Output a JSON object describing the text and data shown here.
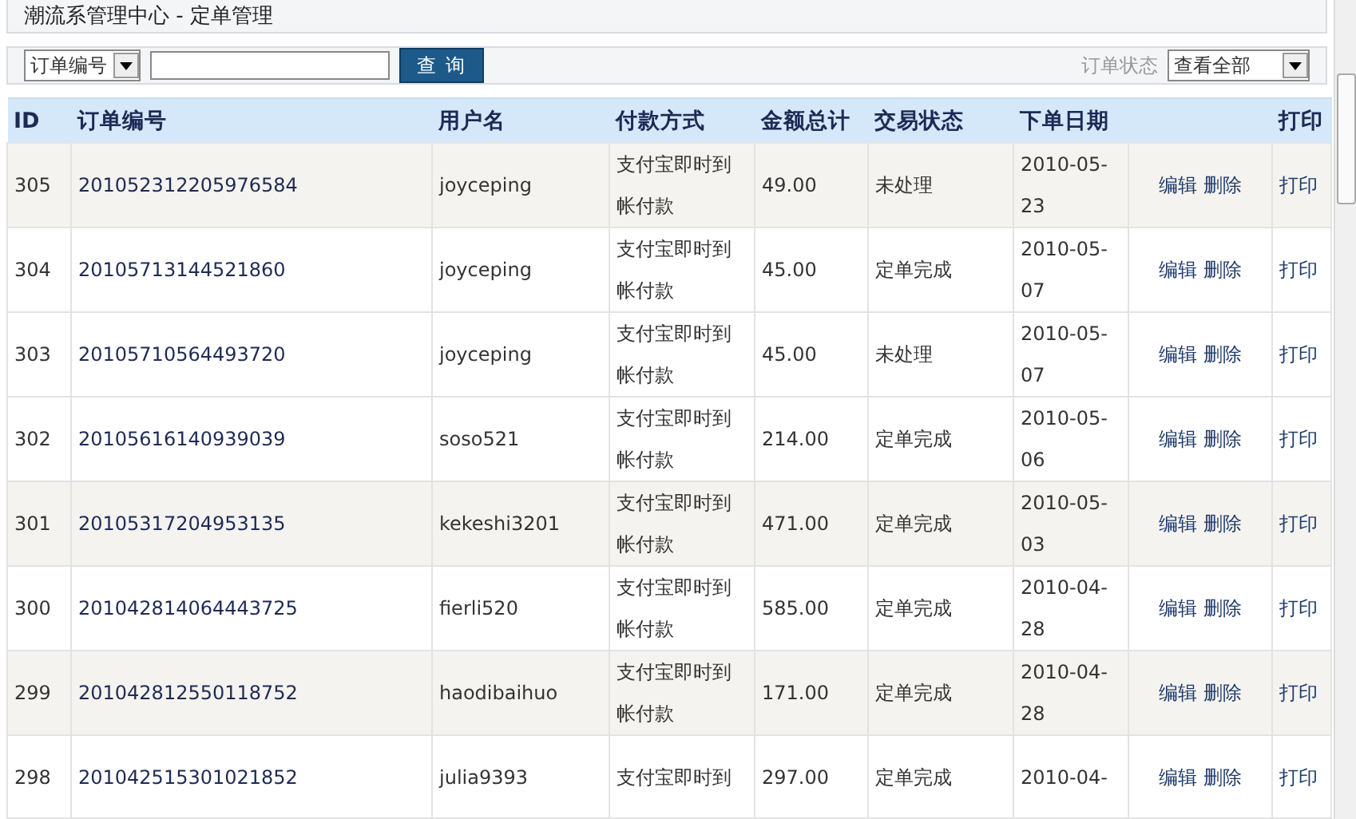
{
  "window": {
    "title": "潮流系管理中心 - 定单管理"
  },
  "search": {
    "field_select": "订单编号",
    "button": "查 询",
    "status_label": "订单状态",
    "status_select": "查看全部"
  },
  "table": {
    "columns": [
      "ID",
      "订单编号",
      "用户名",
      "付款方式",
      "金额总计",
      "交易状态",
      "下单日期",
      "打印"
    ],
    "rows": [
      {
        "id": "305",
        "order_no": "201052312205976584",
        "user": "joyceping",
        "payment": "支付宝即时到帐付款",
        "total": "49.00",
        "status": "未处理",
        "date": "2010-05-23",
        "edit": "编辑",
        "delete": "删除",
        "print": "打印",
        "shaded": true
      },
      {
        "id": "304",
        "order_no": "20105713144521860",
        "user": "joyceping",
        "payment": "支付宝即时到帐付款",
        "total": "45.00",
        "status": "定单完成",
        "date": "2010-05-07",
        "edit": "编辑",
        "delete": "删除",
        "print": "打印",
        "shaded": false
      },
      {
        "id": "303",
        "order_no": "20105710564493720",
        "user": "joyceping",
        "payment": "支付宝即时到帐付款",
        "total": "45.00",
        "status": "未处理",
        "date": "2010-05-07",
        "edit": "编辑",
        "delete": "删除",
        "print": "打印",
        "shaded": false
      },
      {
        "id": "302",
        "order_no": "20105616140939039",
        "user": "soso521",
        "payment": "支付宝即时到帐付款",
        "total": "214.00",
        "status": "定单完成",
        "date": "2010-05-06",
        "edit": "编辑",
        "delete": "删除",
        "print": "打印",
        "shaded": false
      },
      {
        "id": "301",
        "order_no": "20105317204953135",
        "user": "kekeshi3201",
        "payment": "支付宝即时到帐付款",
        "total": "471.00",
        "status": "定单完成",
        "date": "2010-05-03",
        "edit": "编辑",
        "delete": "删除",
        "print": "打印",
        "shaded": true
      },
      {
        "id": "300",
        "order_no": "201042814064443725",
        "user": "fierli520",
        "payment": "支付宝即时到帐付款",
        "total": "585.00",
        "status": "定单完成",
        "date": "2010-04-28",
        "edit": "编辑",
        "delete": "删除",
        "print": "打印",
        "shaded": false
      },
      {
        "id": "299",
        "order_no": "201042812550118752",
        "user": "haodibaihuo",
        "payment": "支付宝即时到帐付款",
        "total": "171.00",
        "status": "定单完成",
        "date": "2010-04-28",
        "edit": "编辑",
        "delete": "删除",
        "print": "打印",
        "shaded": true
      },
      {
        "id": "298",
        "order_no": "201042515301021852",
        "user": "julia9393",
        "payment": "支付宝即时到",
        "total": "297.00",
        "status": "定单完成",
        "date": "2010-04-",
        "edit": "编辑",
        "delete": "删除",
        "print": "打印",
        "shaded": false
      }
    ]
  }
}
